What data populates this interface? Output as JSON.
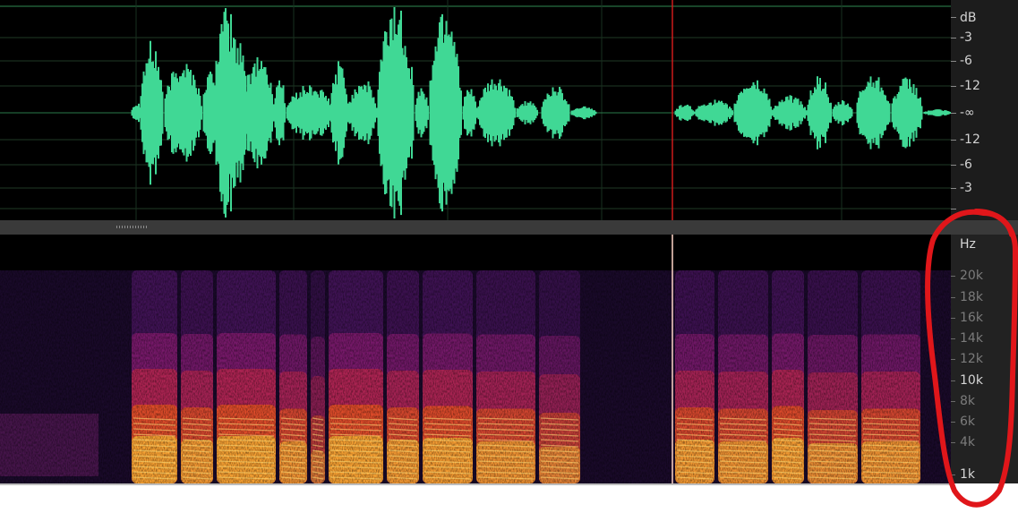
{
  "colors": {
    "waveform": "#40d895",
    "background": "#000000",
    "playhead_wave": "#cc1b1b",
    "playhead_spec": "#ffd6c8",
    "annotation": "#e0161a"
  },
  "amplitude_ruler": {
    "unit": "dB",
    "labels": [
      "-3",
      "-6",
      "-12",
      "-∞",
      "-12",
      "-6",
      "-3"
    ]
  },
  "frequency_ruler": {
    "unit": "Hz",
    "labels": [
      {
        "text": "20k",
        "major": false
      },
      {
        "text": "18k",
        "major": false
      },
      {
        "text": "16k",
        "major": false
      },
      {
        "text": "14k",
        "major": false
      },
      {
        "text": "12k",
        "major": false
      },
      {
        "text": "10k",
        "major": true
      },
      {
        "text": "8k",
        "major": false
      },
      {
        "text": "6k",
        "major": false
      },
      {
        "text": "4k",
        "major": false
      },
      {
        "text": "1k",
        "major": true
      }
    ]
  },
  "annotation_icon": "red-circle-highlight"
}
